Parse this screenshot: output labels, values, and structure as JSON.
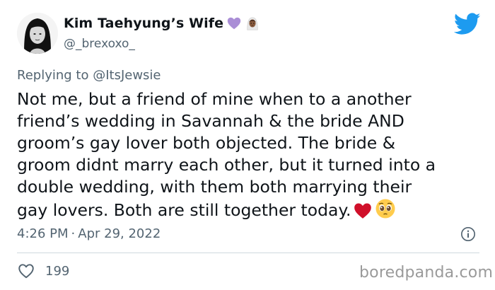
{
  "user": {
    "display_name": "Kim Taehyung’s Wife",
    "name_emojis": [
      "purple-heart",
      "person-with-veil"
    ],
    "handle": "@_brexoxo_"
  },
  "reply": {
    "prefix": "Replying to ",
    "mention": "@ItsJewsie"
  },
  "tweet": {
    "lines": [
      "Not me, but a friend of mine when to a another",
      "friend’s wedding in Savannah & the bride AND",
      "groom’s gay lover both objected. The bride &",
      "groom didnt marry each other, but it turned into a",
      "double wedding, with them both marrying their",
      "gay lovers. Both are still together today."
    ],
    "trailing_emojis": [
      "red-heart",
      "pleading-face"
    ]
  },
  "meta": {
    "time": "4:26 PM",
    "separator": "·",
    "date": "Apr 29, 2022"
  },
  "engagement": {
    "likes": "199"
  },
  "watermark": "boredpanda.com",
  "colors": {
    "text": "#0f1419",
    "secondary": "#536471",
    "twitter_blue": "#1d9bf0",
    "divider": "#cfd9de",
    "heart_red": "#d0102a"
  }
}
